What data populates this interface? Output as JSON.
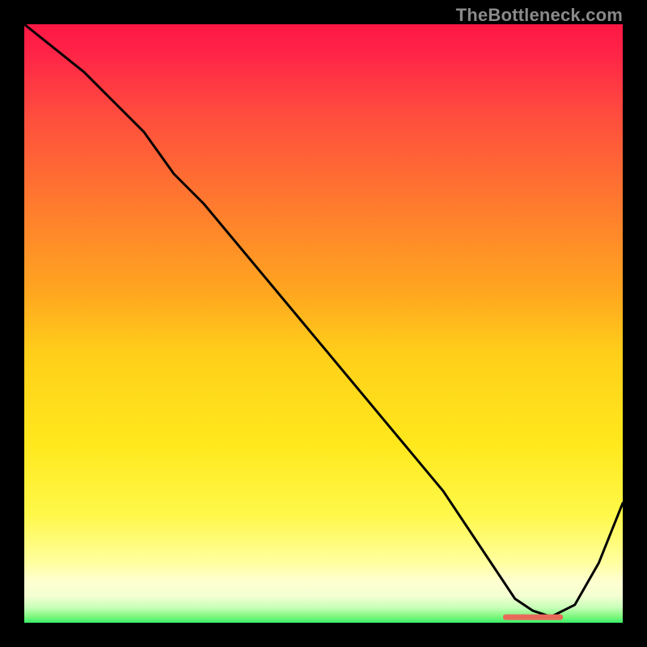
{
  "watermark": "TheBottleneck.com",
  "chart_data": {
    "type": "line",
    "title": "",
    "xlabel": "",
    "ylabel": "",
    "xlim": [
      0,
      100
    ],
    "ylim": [
      0,
      100
    ],
    "grid": false,
    "legend": false,
    "gradient_stops": [
      {
        "offset": 0.0,
        "color": "#ff1744"
      },
      {
        "offset": 0.05,
        "color": "#ff2547"
      },
      {
        "offset": 0.15,
        "color": "#ff4c3e"
      },
      {
        "offset": 0.3,
        "color": "#ff7a2e"
      },
      {
        "offset": 0.45,
        "color": "#ffa71f"
      },
      {
        "offset": 0.55,
        "color": "#ffcf1a"
      },
      {
        "offset": 0.7,
        "color": "#ffe81c"
      },
      {
        "offset": 0.82,
        "color": "#fff84a"
      },
      {
        "offset": 0.9,
        "color": "#ffffa0"
      },
      {
        "offset": 0.93,
        "color": "#ffffd0"
      },
      {
        "offset": 0.955,
        "color": "#f4ffd2"
      },
      {
        "offset": 0.975,
        "color": "#c6ffb8"
      },
      {
        "offset": 0.99,
        "color": "#7cf77c"
      },
      {
        "offset": 1.0,
        "color": "#3af06a"
      }
    ],
    "series": [
      {
        "name": "bottleneck-curve",
        "color": "#000000",
        "x": [
          0,
          10,
          20,
          25,
          30,
          40,
          50,
          60,
          70,
          78,
          82,
          85,
          88,
          92,
          96,
          100
        ],
        "y": [
          100,
          92,
          82,
          75,
          70,
          58,
          46,
          34,
          22,
          10,
          4,
          2,
          1,
          3,
          10,
          20
        ]
      }
    ],
    "highlight": {
      "name": "optimal-zone",
      "color": "#e96a5a",
      "x_start": 80,
      "x_end": 90,
      "y": 1
    }
  }
}
